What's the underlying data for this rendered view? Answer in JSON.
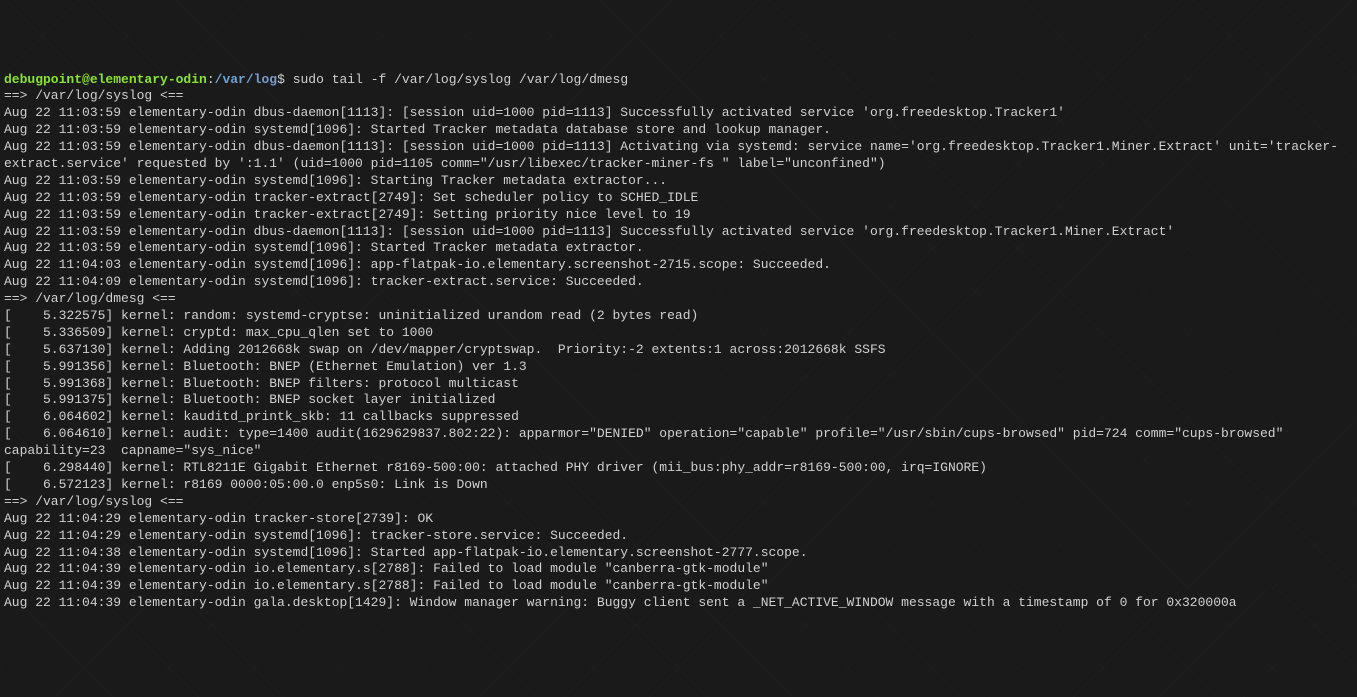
{
  "prompt": {
    "user_host": "debugpoint@elementary-odin",
    "separator": ":",
    "path": "/var/log",
    "dollar": "$",
    "command": "sudo tail -f /var/log/syslog /var/log/dmesg"
  },
  "lines": [
    "==> /var/log/syslog <==",
    "Aug 22 11:03:59 elementary-odin dbus-daemon[1113]: [session uid=1000 pid=1113] Successfully activated service 'org.freedesktop.Tracker1'",
    "Aug 22 11:03:59 elementary-odin systemd[1096]: Started Tracker metadata database store and lookup manager.",
    "Aug 22 11:03:59 elementary-odin dbus-daemon[1113]: [session uid=1000 pid=1113] Activating via systemd: service name='org.freedesktop.Tracker1.Miner.Extract' unit='tracker-extract.service' requested by ':1.1' (uid=1000 pid=1105 comm=\"/usr/libexec/tracker-miner-fs \" label=\"unconfined\")",
    "Aug 22 11:03:59 elementary-odin systemd[1096]: Starting Tracker metadata extractor...",
    "Aug 22 11:03:59 elementary-odin tracker-extract[2749]: Set scheduler policy to SCHED_IDLE",
    "Aug 22 11:03:59 elementary-odin tracker-extract[2749]: Setting priority nice level to 19",
    "Aug 22 11:03:59 elementary-odin dbus-daemon[1113]: [session uid=1000 pid=1113] Successfully activated service 'org.freedesktop.Tracker1.Miner.Extract'",
    "Aug 22 11:03:59 elementary-odin systemd[1096]: Started Tracker metadata extractor.",
    "Aug 22 11:04:03 elementary-odin systemd[1096]: app-flatpak-io.elementary.screenshot-2715.scope: Succeeded.",
    "Aug 22 11:04:09 elementary-odin systemd[1096]: tracker-extract.service: Succeeded.",
    "",
    "==> /var/log/dmesg <==",
    "[    5.322575] kernel: random: systemd-cryptse: uninitialized urandom read (2 bytes read)",
    "[    5.336509] kernel: cryptd: max_cpu_qlen set to 1000",
    "[    5.637130] kernel: Adding 2012668k swap on /dev/mapper/cryptswap.  Priority:-2 extents:1 across:2012668k SSFS",
    "[    5.991356] kernel: Bluetooth: BNEP (Ethernet Emulation) ver 1.3",
    "[    5.991368] kernel: Bluetooth: BNEP filters: protocol multicast",
    "[    5.991375] kernel: Bluetooth: BNEP socket layer initialized",
    "[    6.064602] kernel: kauditd_printk_skb: 11 callbacks suppressed",
    "[    6.064610] kernel: audit: type=1400 audit(1629629837.802:22): apparmor=\"DENIED\" operation=\"capable\" profile=\"/usr/sbin/cups-browsed\" pid=724 comm=\"cups-browsed\" capability=23  capname=\"sys_nice\"",
    "[    6.298440] kernel: RTL8211E Gigabit Ethernet r8169-500:00: attached PHY driver (mii_bus:phy_addr=r8169-500:00, irq=IGNORE)",
    "[    6.572123] kernel: r8169 0000:05:00.0 enp5s0: Link is Down",
    "",
    "==> /var/log/syslog <==",
    "Aug 22 11:04:29 elementary-odin tracker-store[2739]: OK",
    "Aug 22 11:04:29 elementary-odin systemd[1096]: tracker-store.service: Succeeded.",
    "Aug 22 11:04:38 elementary-odin systemd[1096]: Started app-flatpak-io.elementary.screenshot-2777.scope.",
    "Aug 22 11:04:39 elementary-odin io.elementary.s[2788]: Failed to load module \"canberra-gtk-module\"",
    "Aug 22 11:04:39 elementary-odin io.elementary.s[2788]: Failed to load module \"canberra-gtk-module\"",
    "Aug 22 11:04:39 elementary-odin gala.desktop[1429]: Window manager warning: Buggy client sent a _NET_ACTIVE_WINDOW message with a timestamp of 0 for 0x320000a"
  ]
}
